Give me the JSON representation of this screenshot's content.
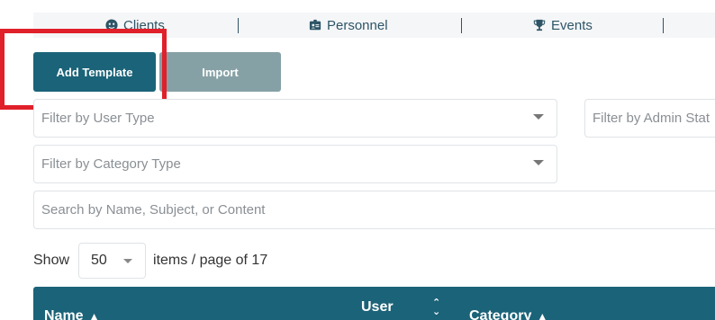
{
  "nav": {
    "items": [
      {
        "label": "Clients",
        "icon": "user-circle-icon"
      },
      {
        "label": "Personnel",
        "icon": "id-badge-icon"
      },
      {
        "label": "Events",
        "icon": "trophy-icon"
      }
    ]
  },
  "actions": {
    "add_label": "Add Template",
    "import_label": "Import"
  },
  "filters": {
    "user_type_placeholder": "Filter by User Type",
    "admin_status_placeholder": "Filter by Admin Stat",
    "category_type_placeholder": "Filter by Category Type",
    "search_placeholder": "Search by Name, Subject, or Content"
  },
  "pagination": {
    "show_label": "Show",
    "page_size": "50",
    "suffix_label": "items / page of 17"
  },
  "table": {
    "columns": [
      {
        "label": "Name",
        "sort_icon": "sort-up-icon"
      },
      {
        "label": "User",
        "sort_icon": "sort-both-icon"
      },
      {
        "label": "Category",
        "sort_icon": "sort-up-icon"
      }
    ]
  },
  "colors": {
    "primary": "#1b6378",
    "secondary": "#86a1a6",
    "highlight": "#e0202a",
    "nav_text": "#2d5566"
  }
}
